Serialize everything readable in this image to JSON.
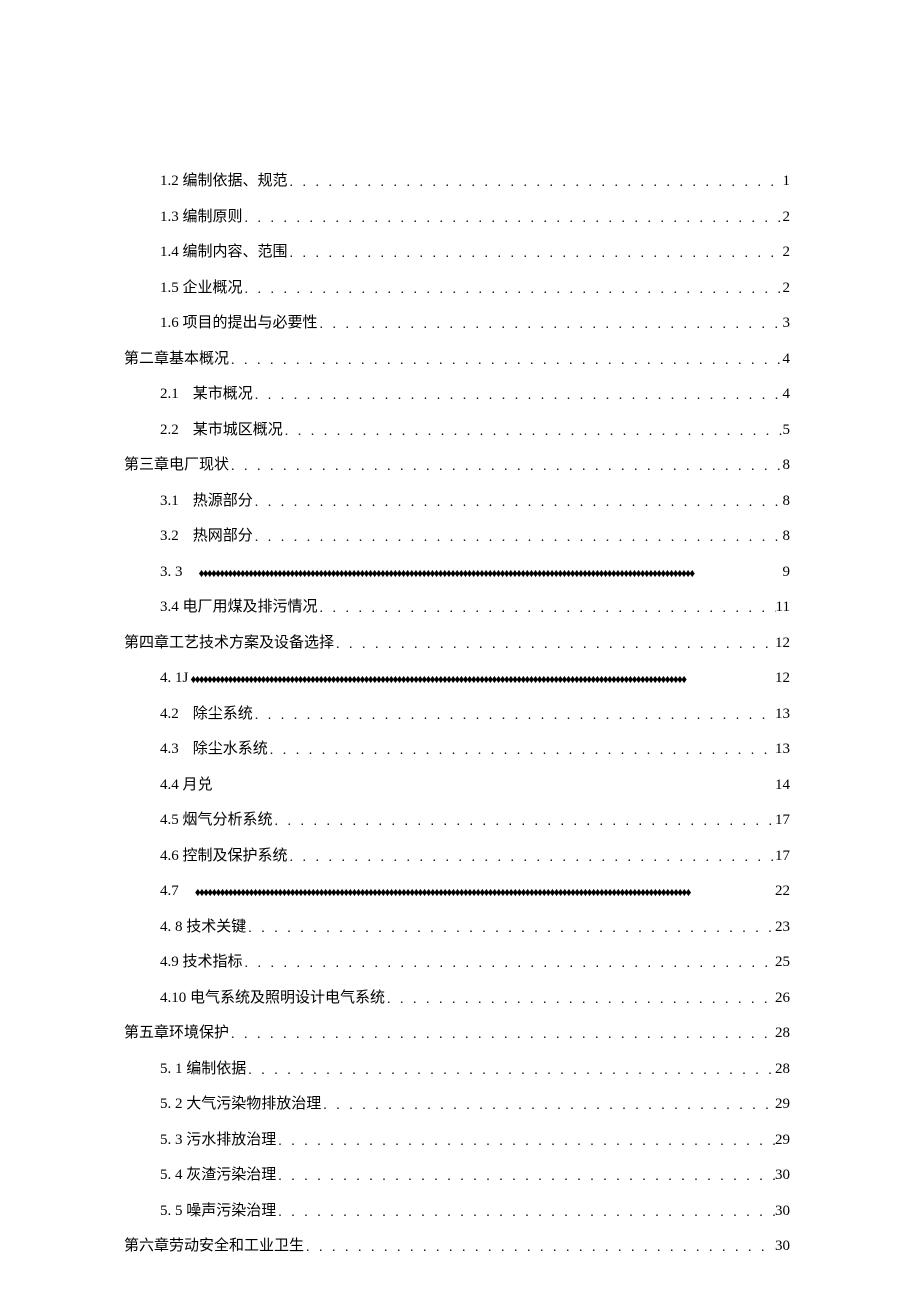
{
  "toc": [
    {
      "indent": true,
      "prefix": "1.2",
      "title": "编制依据、规范",
      "page": "1",
      "leader": "dot"
    },
    {
      "indent": true,
      "prefix": "1.3",
      "title": "编制原则",
      "page": "2",
      "leader": "dot"
    },
    {
      "indent": true,
      "prefix": "1.4",
      "title": "编制内容、范围",
      "page": "2",
      "leader": "dot"
    },
    {
      "indent": true,
      "prefix": "1.5",
      "title": "企业概况",
      "page": "2",
      "leader": "dot"
    },
    {
      "indent": true,
      "prefix": "1.6",
      "title": "项目的提出与必要性",
      "page": "3",
      "leader": "dot"
    },
    {
      "indent": false,
      "prefix": "",
      "title": "第二章基本概况",
      "page": "4",
      "leader": "dot"
    },
    {
      "indent": true,
      "prefix": "2.1",
      "title": "某市概况",
      "page": "4",
      "leader": "dot",
      "gap": true
    },
    {
      "indent": true,
      "prefix": "2.2",
      "title": "某市城区概况",
      "page": "5",
      "leader": "dot",
      "gap": true
    },
    {
      "indent": false,
      "prefix": "",
      "title": "第三章电厂现状",
      "page": "8",
      "leader": "dot"
    },
    {
      "indent": true,
      "prefix": "3.1",
      "title": "热源部分",
      "page": "8",
      "leader": "dot",
      "gap": true
    },
    {
      "indent": true,
      "prefix": "3.2",
      "title": "热网部分",
      "page": "8",
      "leader": "dot",
      "gap": true
    },
    {
      "indent": true,
      "prefix": "3.  3",
      "title": "",
      "page": "9",
      "leader": "diamond",
      "gap": true
    },
    {
      "indent": true,
      "prefix": "3.4",
      "title": "电厂用煤及排污情况",
      "page": "11",
      "leader": "dot"
    },
    {
      "indent": false,
      "prefix": "",
      "title": "第四章工艺技术方案及设备选择",
      "page": "12",
      "leader": "dot"
    },
    {
      "indent": true,
      "prefix": "4.   1J",
      "title": "",
      "page": "12",
      "leader": "diamond"
    },
    {
      "indent": true,
      "prefix": "4.2",
      "title": "除尘系统",
      "page": "13",
      "leader": "dot",
      "gap": true
    },
    {
      "indent": true,
      "prefix": "4.3",
      "title": "除尘水系统",
      "page": "13",
      "leader": "dot",
      "gap": true
    },
    {
      "indent": true,
      "prefix": "4.4",
      "title": "月兑",
      "page": "14",
      "leader": "none"
    },
    {
      "indent": true,
      "prefix": "4.5",
      "title": "烟气分析系统",
      "page": "17",
      "leader": "dot"
    },
    {
      "indent": true,
      "prefix": "4.6",
      "title": "控制及保护系统",
      "page": "17",
      "leader": "dot"
    },
    {
      "indent": true,
      "prefix": "4.7",
      "title": "",
      "page": "22",
      "leader": "diamond",
      "gap": true
    },
    {
      "indent": true,
      "prefix": "4.  8",
      "title": "技术关键",
      "page": "23",
      "leader": "dot"
    },
    {
      "indent": true,
      "prefix": "4.9",
      "title": "技术指标",
      "page": "25",
      "leader": "dot"
    },
    {
      "indent": true,
      "prefix": "4.10",
      "title": "电气系统及照明设计电气系统",
      "page": "26",
      "leader": "dot"
    },
    {
      "indent": false,
      "prefix": "",
      "title": "第五章环境保护",
      "page": "28",
      "leader": "dot"
    },
    {
      "indent": true,
      "prefix": "5.  1",
      "title": "编制依据",
      "page": "28",
      "leader": "dot"
    },
    {
      "indent": true,
      "prefix": "5.  2",
      "title": "大气污染物排放治理",
      "page": "29",
      "leader": "dot"
    },
    {
      "indent": true,
      "prefix": "5.  3",
      "title": "污水排放治理",
      "page": "29",
      "leader": "dot"
    },
    {
      "indent": true,
      "prefix": "5.  4",
      "title": "灰渣污染治理",
      "page": "30",
      "leader": "dot"
    },
    {
      "indent": true,
      "prefix": "5.  5",
      "title": "噪声污染治理",
      "page": "30",
      "leader": "dot"
    },
    {
      "indent": false,
      "prefix": "",
      "title": "第六章劳动安全和工业卫生",
      "page": "30",
      "leader": "dot"
    }
  ],
  "leaders": {
    "dot": ". . . . . . . . . . . . . . . . . . . . . . . . . . . . . . . . . . . . . . . . . . . . . . . . . . . . . . . . . . . . . . . . . . . . . . . . . . . . . . . . . . . . . . . . . . . . . . . . . . . . .",
    "diamond": "♦♦♦♦♦♦♦♦♦♦♦♦♦♦♦♦♦♦♦♦♦♦♦♦♦♦♦♦♦♦♦♦♦♦♦♦♦♦♦♦♦♦♦♦♦♦♦♦♦♦♦♦♦♦♦♦♦♦♦♦♦♦♦♦♦♦♦♦♦♦♦♦♦♦♦♦♦♦♦♦♦♦♦♦♦♦♦♦♦♦♦♦♦♦♦♦♦♦♦♦♦♦♦♦♦♦♦♦♦♦♦♦♦♦♦♦♦♦♦♦",
    "none": ""
  }
}
